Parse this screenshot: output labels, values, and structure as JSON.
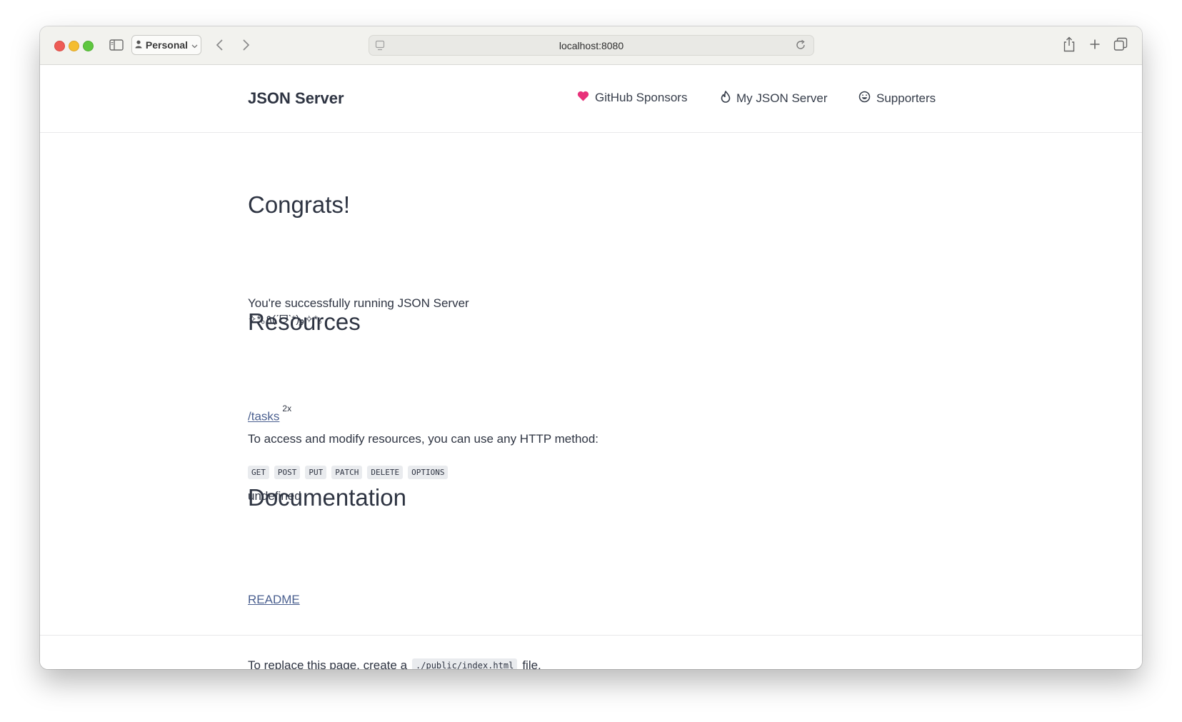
{
  "browser": {
    "profile_label": "Personal",
    "url": "localhost:8080"
  },
  "site": {
    "brand": "JSON Server",
    "nav": [
      {
        "label": "GitHub Sponsors",
        "icon": "heart-icon",
        "icon_color": "#e8317a"
      },
      {
        "label": "My JSON Server",
        "icon": "flame-icon"
      },
      {
        "label": "Supporters",
        "icon": "smiley-icon"
      }
    ]
  },
  "main": {
    "congrats_heading": "Congrats!",
    "running_text": "You're successfully running JSON Server",
    "kaomoji": "✧*｡٩(ˊᗜˋ*)و✧*｡",
    "resources_heading": "Resources",
    "resource": {
      "path": "/tasks",
      "count": "2x"
    },
    "access_text": "To access and modify resources, you can use any HTTP method:",
    "methods": [
      "GET",
      "POST",
      "PUT",
      "PATCH",
      "DELETE",
      "OPTIONS"
    ],
    "undefined_text": "undefined",
    "docs_heading": "Documentation",
    "readme_label": "README"
  },
  "footer": {
    "prefix": "To replace this page, create a",
    "code": "./public/index.html",
    "suffix": "file."
  },
  "colors": {
    "link": "#4a5f8f",
    "text": "#2e3442",
    "heart": "#e8317a"
  }
}
